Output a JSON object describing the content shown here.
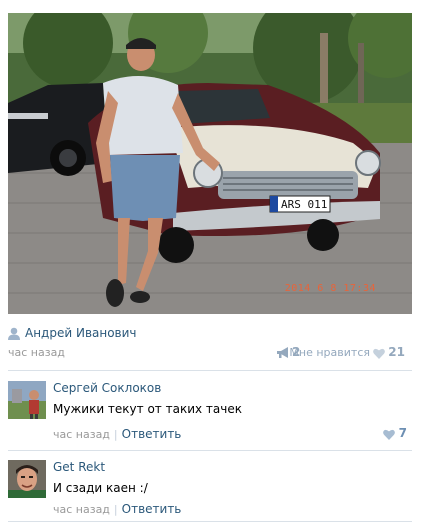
{
  "post": {
    "photo_alt": "",
    "photo_stamp": "2014 6 8 17:34",
    "plate_text": "ARS 011",
    "author_icon": "user-icon",
    "author_name": "Андрей Иванович",
    "time": "час назад",
    "share_icon": "megaphone-icon",
    "share_count": "2",
    "like_label": "Мне нравится",
    "like_icon": "heart-icon",
    "like_count": "21"
  },
  "comments": [
    {
      "author": "Сергей Соклоков",
      "text": "Мужики текут от таких тачек",
      "time": "час назад",
      "reply_label": "Ответить",
      "like_count": "7"
    },
    {
      "author": "Get Rekt",
      "text": "И сзади каен :/",
      "time": "час назад",
      "reply_label": "Ответить",
      "like_count": ""
    }
  ],
  "colors": {
    "link": "#2b587a",
    "muted": "#999999",
    "like": "#94a8bd",
    "divider": "#dae1e8"
  }
}
